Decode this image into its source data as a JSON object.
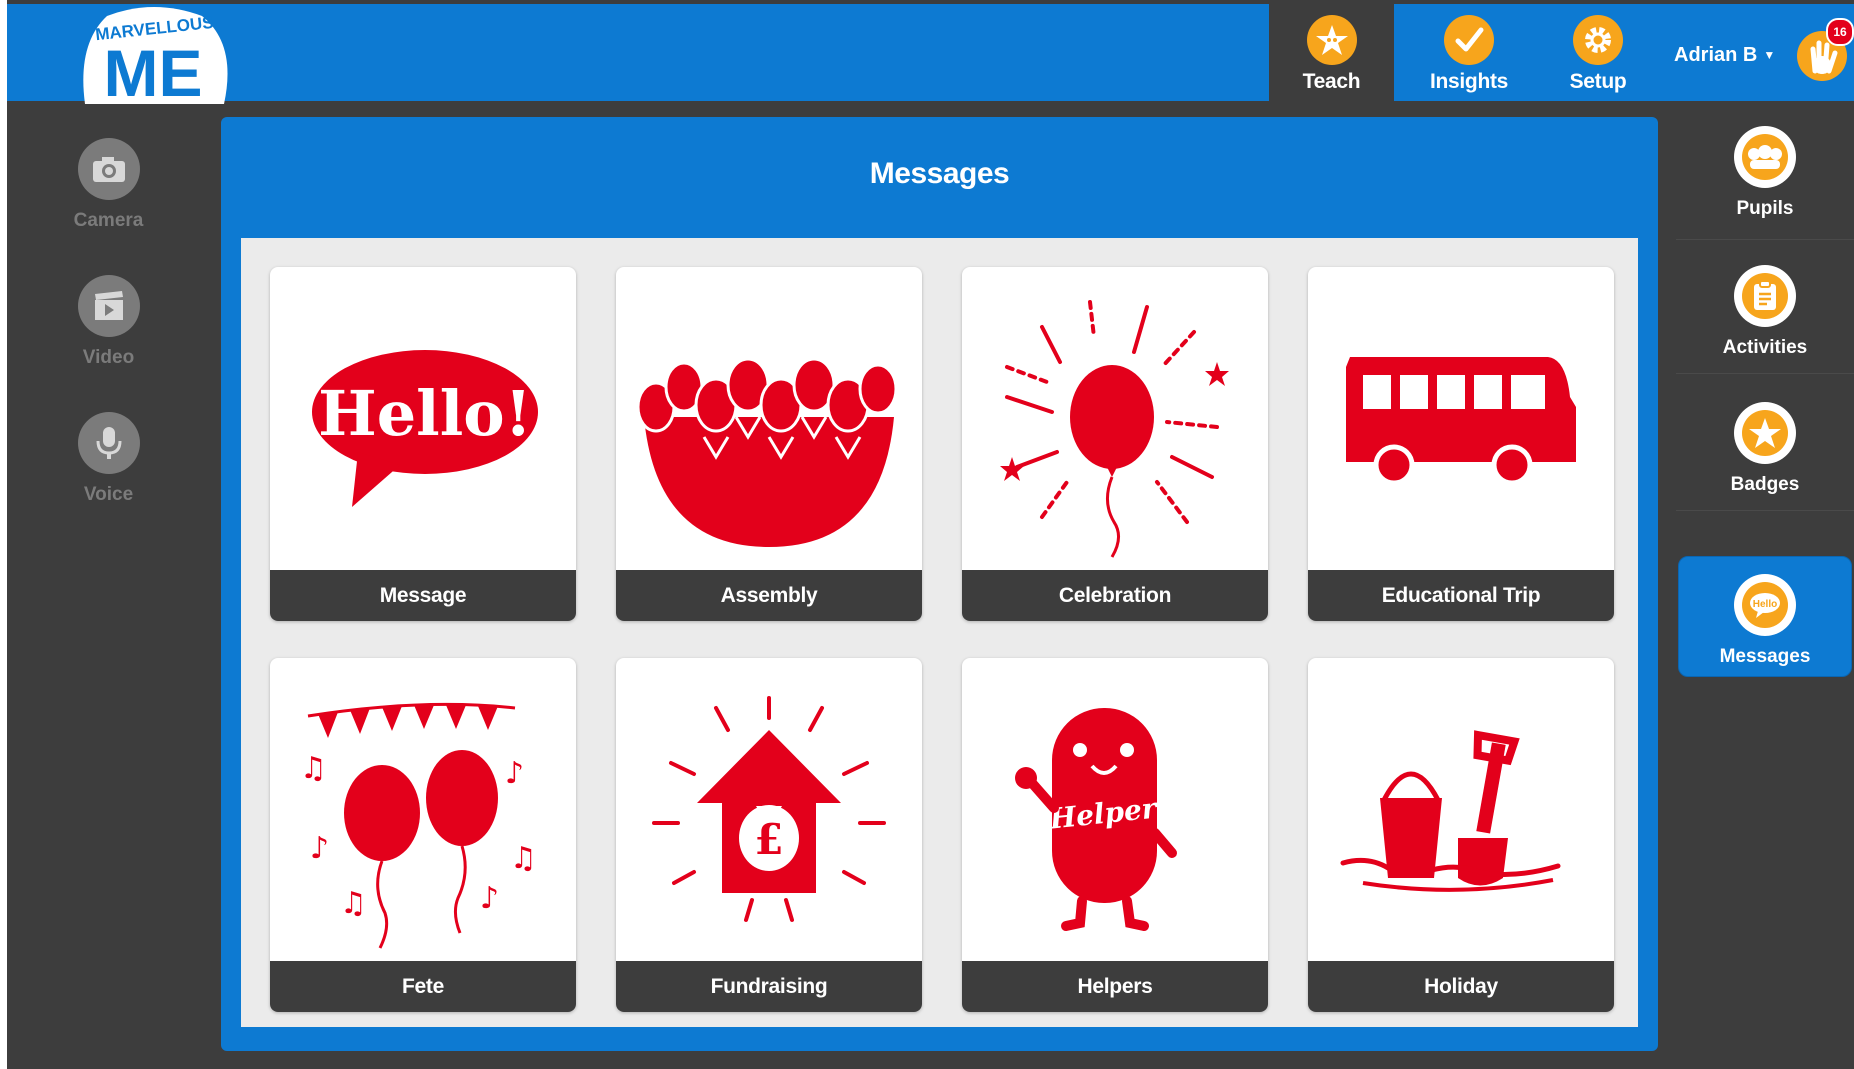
{
  "app": {
    "logo_top": "MARVELLOUS",
    "logo_main": "ME"
  },
  "nav": [
    {
      "label": "Teach",
      "icon": "star-icon",
      "active": true
    },
    {
      "label": "Insights",
      "icon": "check-icon"
    },
    {
      "label": "Setup",
      "icon": "gear-icon"
    }
  ],
  "user": {
    "name": "Adrian B",
    "notifications": "16"
  },
  "left_sidebar": [
    {
      "label": "Camera",
      "icon": "camera-icon"
    },
    {
      "label": "Video",
      "icon": "video-icon"
    },
    {
      "label": "Voice",
      "icon": "microphone-icon"
    }
  ],
  "right_sidebar": [
    {
      "label": "Pupils",
      "icon": "pupils-icon"
    },
    {
      "label": "Activities",
      "icon": "clipboard-icon"
    },
    {
      "label": "Badges",
      "icon": "badge-icon"
    },
    {
      "label": "Messages",
      "icon": "hello-speech-icon",
      "active": true
    }
  ],
  "main": {
    "title": "Messages",
    "cards": [
      {
        "label": "Message",
        "icon": "hello-speech-bubble-icon"
      },
      {
        "label": "Assembly",
        "icon": "assembly-crowd-icon"
      },
      {
        "label": "Celebration",
        "icon": "celebration-balloon-icon"
      },
      {
        "label": "Educational Trip",
        "icon": "bus-icon"
      },
      {
        "label": "Fete",
        "icon": "fete-balloons-icon"
      },
      {
        "label": "Fundraising",
        "icon": "fundraising-house-icon"
      },
      {
        "label": "Helpers",
        "icon": "helper-character-icon"
      },
      {
        "label": "Holiday",
        "icon": "bucket-spade-icon"
      }
    ],
    "card_art_texts": {
      "hello": "Hello!",
      "pound": "£",
      "helper": "Helper"
    }
  },
  "colors": {
    "brand_blue": "#0d7ad2",
    "dark_bg": "#3d3d3d",
    "accent_orange": "#f7a51c",
    "icon_red": "#e3001b",
    "grid_bg": "#ebebeb"
  }
}
